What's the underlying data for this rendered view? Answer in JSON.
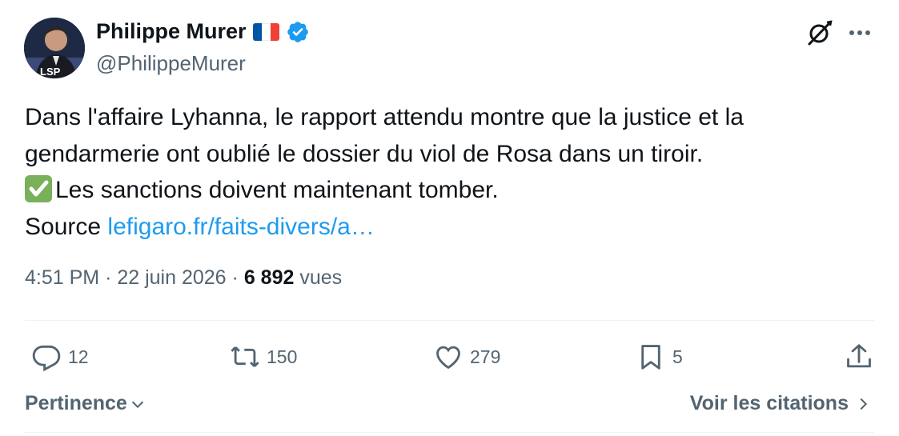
{
  "author": {
    "name": "Philippe Murer",
    "handle": "@PhilippeMurer",
    "verified": true
  },
  "tweet": {
    "lines": [
      "Dans l'affaire Lyhanna, le rapport attendu montre que la justice et la",
      "gendarmerie ont oublié le dossier du viol de Rosa dans un tiroir.",
      "Les sanctions doivent maintenant tomber."
    ],
    "source_label": "Source",
    "link_text": "lefigaro.fr/faits-divers/a…"
  },
  "meta": {
    "time": "4:51 PM",
    "separator": "·",
    "date": "22 juin 2026",
    "views_count": "6 892",
    "views_label": "vues"
  },
  "actions": {
    "replies": "12",
    "reposts": "150",
    "likes": "279",
    "bookmarks": "5"
  },
  "footer": {
    "sort_label": "Pertinence",
    "quotes_label": "Voir les citations"
  },
  "colors": {
    "accent": "#1d9bf0",
    "text": "#0f1419",
    "secondary": "#536471"
  },
  "icons": [
    "grok-icon",
    "more-icon",
    "reply-icon",
    "repost-icon",
    "like-icon",
    "bookmark-icon",
    "share-icon",
    "chevron-down-icon",
    "chevron-right-icon",
    "verified-badge-icon",
    "check-emoji-icon",
    "flag-fr-icon"
  ]
}
